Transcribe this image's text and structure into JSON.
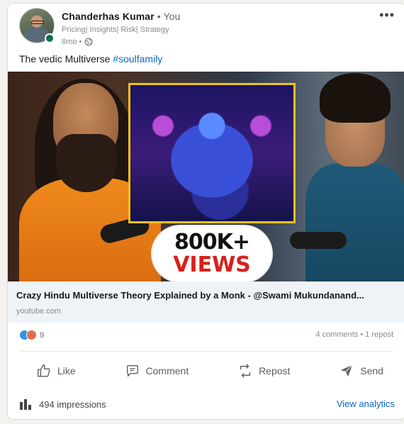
{
  "post": {
    "author": {
      "name": "Chanderhas Kumar",
      "you_label": " • You",
      "headline": "Pricing| Insights| Risk| Strategy",
      "time": "8mo •"
    },
    "text": "The vedic Multiverse ",
    "hashtag": "#soulfamily",
    "more_icon": "•••",
    "thumbnail": {
      "badge_number": "800K+",
      "badge_word": "VIEWS"
    },
    "link": {
      "title": "Crazy Hindu Multiverse Theory Explained by a Monk - @Swami Mukundanand...",
      "domain": "youtube.com"
    },
    "social": {
      "reaction_count": "9",
      "comments": "4 comments",
      "separator": " • ",
      "reposts": "1 repost"
    },
    "actions": {
      "like": "Like",
      "comment": "Comment",
      "repost": "Repost",
      "send": "Send"
    },
    "footer": {
      "impressions": "494 impressions",
      "analytics": "View analytics"
    },
    "colors": {
      "link_blue": "#0a66c2",
      "online_green": "#057642",
      "badge_red": "#d8201a",
      "frame_gold": "#f2c214"
    }
  }
}
